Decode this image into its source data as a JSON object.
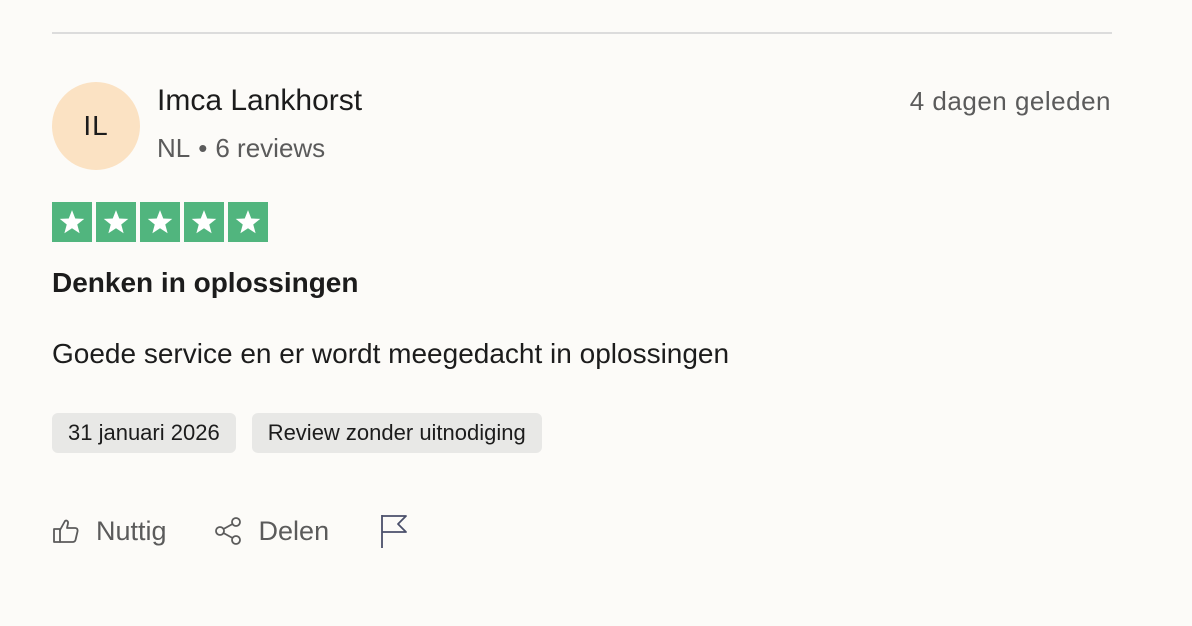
{
  "reviewer": {
    "initials": "IL",
    "name": "Imca Lankhorst",
    "country": "NL",
    "separator": "•",
    "review_count": "6 reviews"
  },
  "review": {
    "time_ago": "4 dagen geleden",
    "rating": 5,
    "rating_max": 5,
    "star_color": "#51b57e",
    "title": "Denken in oplossingen",
    "body": "Goede service en er wordt meegedacht in oplossingen",
    "tags": [
      "31 januari 2026",
      "Review zonder uitnodiging"
    ]
  },
  "actions": {
    "helpful_label": "Nuttig",
    "helpful_icon": "thumbs-up-icon",
    "share_label": "Delen",
    "share_icon": "share-icon",
    "report_icon": "flag-icon"
  },
  "colors": {
    "avatar_bg": "#fbe2c3",
    "tag_bg": "#e8e8e6",
    "muted_text": "#5b5b5b"
  }
}
